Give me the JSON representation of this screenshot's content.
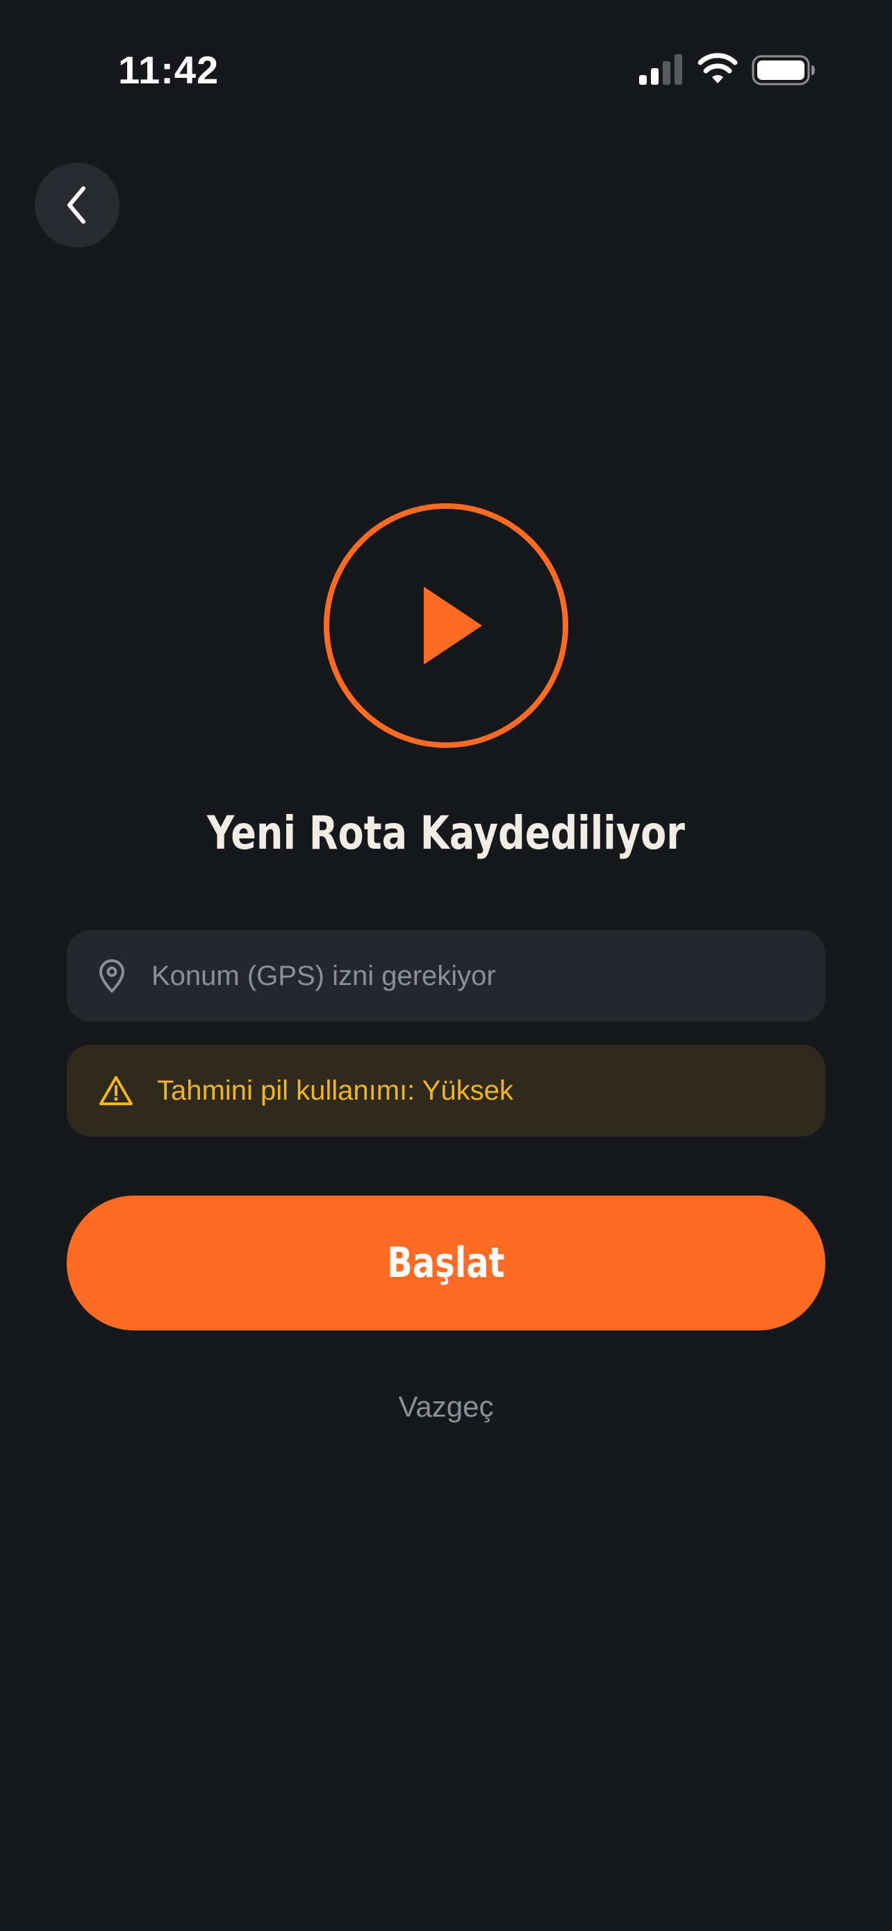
{
  "status_bar": {
    "time": "11:42",
    "icons": [
      "signal-icon",
      "wifi-icon",
      "battery-icon"
    ]
  },
  "header": {
    "back_icon": "chevron-left-icon"
  },
  "main": {
    "hero_icon": "play-circle-icon",
    "title": "Yeni Rota Kaydediliyor",
    "gps_notice": {
      "icon": "location-pin-icon",
      "text": "Konum (GPS) izni gerekiyor"
    },
    "battery_notice": {
      "icon": "warning-icon",
      "text": "Tahmini pil kullanımı: Yüksek"
    },
    "start_label": "Başlat",
    "cancel_label": "Vazgeç"
  },
  "colors": {
    "background": "#17181c",
    "accent": "#ff6b22",
    "warning": "#f2b51f",
    "muted_text": "#8e8f96",
    "title_text": "#f2ede4"
  }
}
